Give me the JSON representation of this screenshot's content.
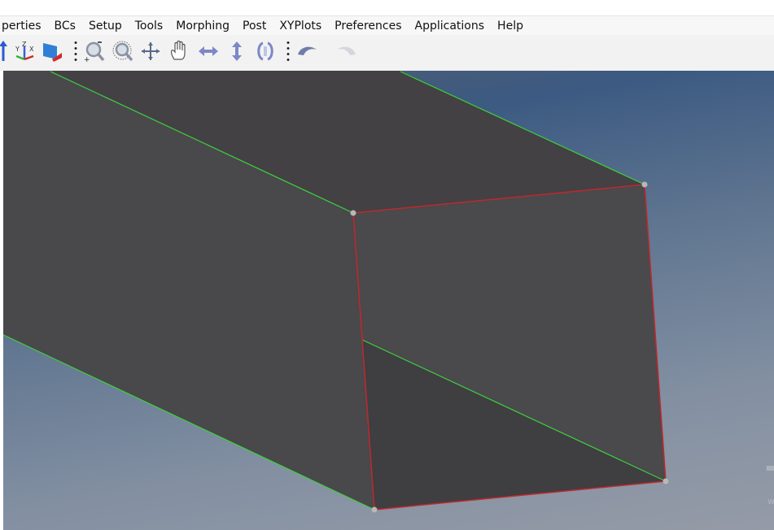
{
  "menubar": {
    "items": [
      "perties",
      "BCs",
      "Setup",
      "Tools",
      "Morphing",
      "Post",
      "XYPlots",
      "Preferences",
      "Applications",
      "Help"
    ]
  },
  "toolbar": {
    "icons": [
      "axis-arrow-icon",
      "xyz-axes-icon",
      "display-plane-icon",
      "zoom-window-icon",
      "zoom-dynamic-icon",
      "rotate-move-icon",
      "pan-hand-icon",
      "horizontal-arrows-icon",
      "vertical-arrows-icon",
      "spin-icon",
      "undo-view-icon",
      "redo-view-icon"
    ]
  },
  "viewport": {
    "background_top": "#3c5a82",
    "background_bottom": "#959ba7",
    "face_color": "#48474a",
    "edge_free_color": "#3cd23c",
    "edge_shared_color": "#c0282c"
  },
  "watermark": {
    "text": "下载吧",
    "url_text": "www.xiazaiba.com"
  }
}
